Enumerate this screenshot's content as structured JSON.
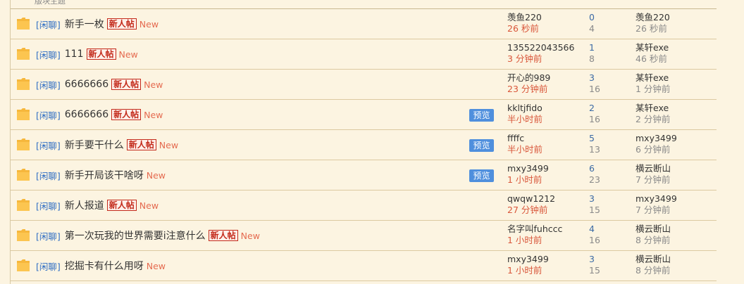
{
  "top_partial_text": "版块主题",
  "preview_label": "预览",
  "threads": [
    {
      "tag": "[闲聊]",
      "title": "新手一枚",
      "newbie": "新人帖",
      "new": "New",
      "preview": false,
      "author": "羡鱼220",
      "author_time": "26 秒前",
      "replies": "0",
      "views": "4",
      "last_user": "羡鱼220",
      "last_time": "26 秒前"
    },
    {
      "tag": "[闲聊]",
      "title": "111",
      "newbie": "新人帖",
      "new": "New",
      "preview": false,
      "author": "135522043566",
      "author_time": "3 分钟前",
      "replies": "1",
      "views": "8",
      "last_user": "某轩exe",
      "last_time": "46 秒前"
    },
    {
      "tag": "[闲聊]",
      "title": "6666666",
      "newbie": "新人帖",
      "new": "New",
      "preview": false,
      "author": "开心的989",
      "author_time": "23 分钟前",
      "replies": "3",
      "views": "16",
      "last_user": "某轩exe",
      "last_time": "1 分钟前"
    },
    {
      "tag": "[闲聊]",
      "title": "6666666",
      "newbie": "新人帖",
      "new": "New",
      "preview": true,
      "author": "kkltjfido",
      "author_time": "半小时前",
      "replies": "2",
      "views": "16",
      "last_user": "某轩exe",
      "last_time": "2 分钟前"
    },
    {
      "tag": "[闲聊]",
      "title": "新手要干什么",
      "newbie": "新人帖",
      "new": "New",
      "preview": true,
      "author": "ffffc",
      "author_time": "半小时前",
      "replies": "5",
      "views": "13",
      "last_user": "mxy3499",
      "last_time": "6 分钟前"
    },
    {
      "tag": "[闲聊]",
      "title": "新手开局该干啥呀",
      "newbie": "",
      "new": "New",
      "preview": true,
      "author": "mxy3499",
      "author_time": "1 小时前",
      "replies": "6",
      "views": "23",
      "last_user": "横云断山",
      "last_time": "7 分钟前"
    },
    {
      "tag": "[闲聊]",
      "title": "新人报道",
      "newbie": "新人帖",
      "new": "New",
      "preview": false,
      "author": "qwqw1212",
      "author_time": "27 分钟前",
      "replies": "3",
      "views": "15",
      "last_user": "mxy3499",
      "last_time": "7 分钟前"
    },
    {
      "tag": "[闲聊]",
      "title": "第一次玩我的世界需要i注意什么",
      "newbie": "新人帖",
      "new": "New",
      "preview": false,
      "author": "名字叫fuhccc",
      "author_time": "1 小时前",
      "replies": "4",
      "views": "16",
      "last_user": "横云断山",
      "last_time": "8 分钟前"
    },
    {
      "tag": "[闲聊]",
      "title": "挖掘卡有什么用呀",
      "newbie": "",
      "new": "New",
      "preview": false,
      "author": "mxy3499",
      "author_time": "1 小时前",
      "replies": "3",
      "views": "15",
      "last_user": "横云断山",
      "last_time": "8 分钟前"
    }
  ]
}
